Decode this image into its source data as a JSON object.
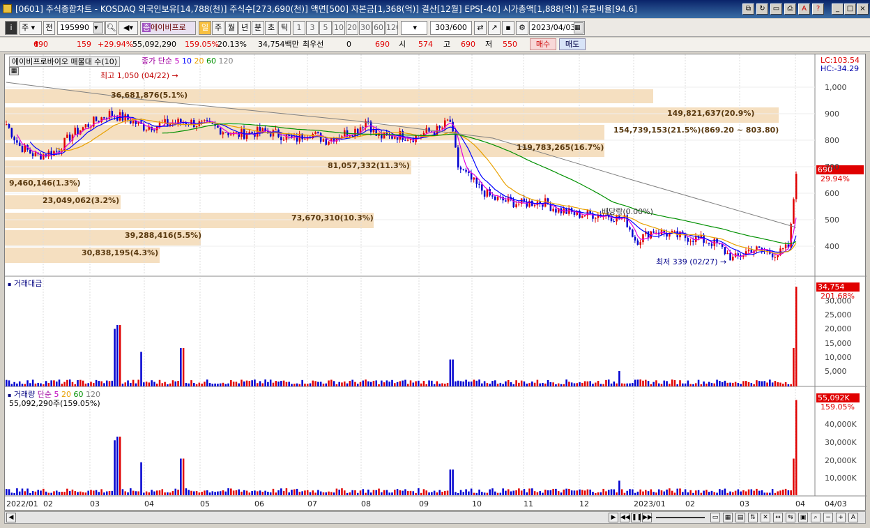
{
  "window": {
    "title": "[0601] 주식종합차트 - KOSDAQ 외국인보유[14,788(천)] 주식수[273,690(천)] 액면[500] 자본금[1,368(억)] 결산[12월] EPS[-40] 시가총액[1,888(억)] 유통비율[94.6]"
  },
  "toolbar": {
    "market": "주",
    "prev_label": "전",
    "code": "195990",
    "stock_name": "에이비프로",
    "periods": [
      "일",
      "주",
      "월",
      "년",
      "분",
      "초",
      "틱"
    ],
    "active_period": "일",
    "intervals": [
      "1",
      "3",
      "5",
      "10",
      "20",
      "30",
      "60",
      "120"
    ],
    "count": "303",
    "total": "/600",
    "date": "2023/04/03"
  },
  "quote": {
    "price": "690",
    "change": "159",
    "change_pct": "+29.94%",
    "volume": "55,092,290",
    "vol_ratio": "159.05%",
    "turnover": "20.13%",
    "amount": "34,754백만",
    "pref_label": "최우선",
    "pref_value": "0",
    "pref_price": "690",
    "open_label": "시",
    "open": "574",
    "high_label": "고",
    "high": "690",
    "low_label": "저",
    "low": "550",
    "buy": "매수",
    "sell": "매도"
  },
  "price_panel": {
    "title": "에이비프로바이오 매물대 수(10)",
    "ma_label": "종가 단순",
    "ma_periods": [
      "5",
      "10",
      "20",
      "60",
      "120"
    ],
    "lc": "LC:103.54",
    "hc": "HC:-34.29",
    "high_note": "최고 1,050 (04/22)",
    "low_note": "최저 339 (02/27)",
    "rate_note": "배당락(0.00%)",
    "price_tag": "690",
    "pct_tag": "29.94%",
    "y_ticks": [
      "1,000",
      "900",
      "800",
      "700",
      "600",
      "500",
      "400"
    ],
    "volume_profile": [
      "36,681,876(5.1%)",
      "149,821,637(20.9%)",
      "154,739,153(21.5%)(869.20 ~ 803.80)",
      "119,783,265(16.7%)",
      "81,057,332(11.3%)",
      "9,460,146(1.3%)",
      "23,049,062(3.2%)",
      "73,670,310(10.3%)",
      "39,288,416(5.5%)",
      "30,838,195(4.3%)"
    ]
  },
  "amount_panel": {
    "title": "거래대금",
    "tag": "34,754",
    "pct_tag": "201.68%",
    "y_ticks": [
      "30,000",
      "25,000",
      "20,000",
      "15,000",
      "10,000",
      "5,000"
    ]
  },
  "volume_panel": {
    "title": "거래량",
    "ma_label": "단순",
    "ma_periods": [
      "5",
      "20",
      "60",
      "120"
    ],
    "value_line": "55,092,290주(159.05%)",
    "tag": "55,092K",
    "pct_tag": "159.05%",
    "y_ticks": [
      "40,000K",
      "30,000K",
      "20,000K",
      "10,000K"
    ]
  },
  "x_axis": [
    "2022/01",
    "02",
    "03",
    "04",
    "05",
    "06",
    "07",
    "08",
    "09",
    "10",
    "11",
    "12",
    "2023/01",
    "02",
    "03",
    "04",
    "04/03"
  ],
  "colors": {
    "up": "#e00000",
    "down": "#0000d0",
    "profile": "#f5dfc0",
    "ma5": "#e000e0",
    "ma10": "#0000ff",
    "ma20": "#e8a000",
    "ma60": "#009000",
    "ma120": "#808080"
  }
}
